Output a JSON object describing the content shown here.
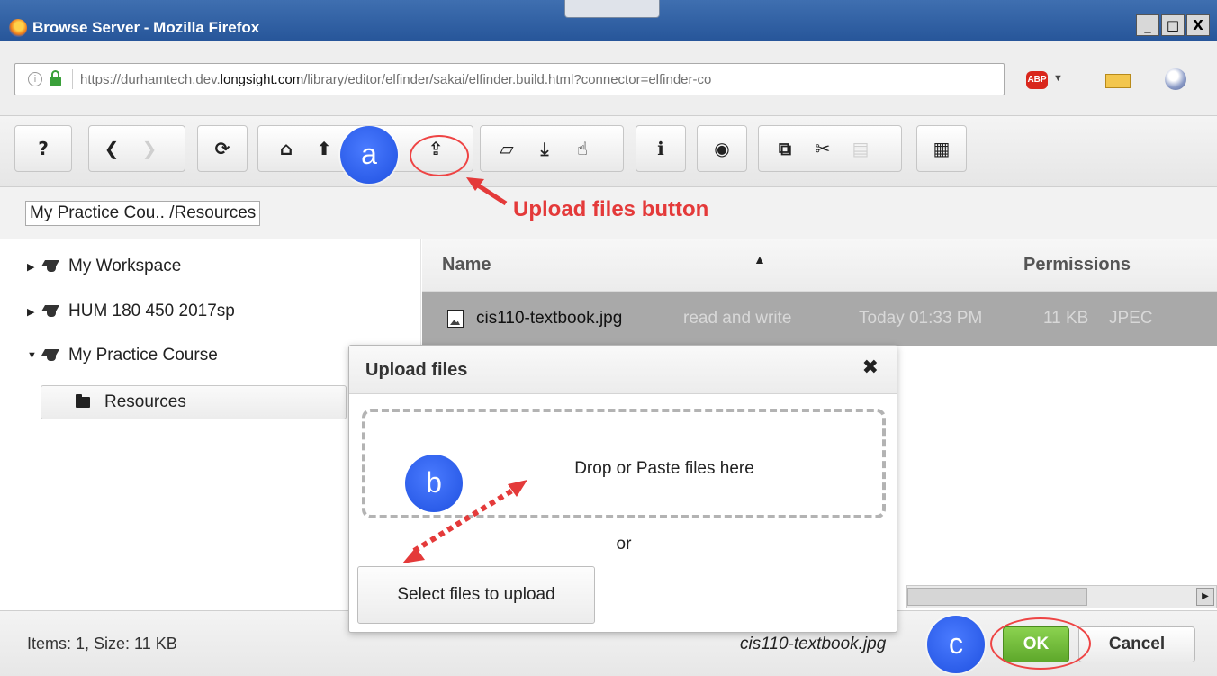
{
  "window": {
    "title": "Browse Server - Mozilla Firefox",
    "controls": [
      "_",
      "□",
      "X"
    ]
  },
  "address_bar": {
    "url_prefix": "https://durhamtech.dev.",
    "url_host": "longsight.com",
    "url_suffix": "/library/editor/elfinder/sakai/elfinder.build.html?connector=elfinder-co",
    "adblock_label": "ABP"
  },
  "toolbar": {
    "buttons": [
      "help-icon",
      "back-icon",
      "forward-icon",
      "reload-icon",
      "home-icon",
      "up-icon",
      "upload-icon",
      "open-icon",
      "download-icon",
      "select-icon",
      "info-icon",
      "preview-icon",
      "copy-icon",
      "cut-icon",
      "paste-icon",
      "view-icon"
    ]
  },
  "breadcrumb": {
    "path": "My Practice Cou.. /Resources"
  },
  "tree": {
    "items": [
      {
        "label": "My Workspace",
        "expanded": false
      },
      {
        "label": "HUM 180 450 2017sp",
        "expanded": false
      },
      {
        "label": "My Practice Course",
        "expanded": true
      }
    ],
    "selected_folder": "Resources"
  },
  "list": {
    "headers": {
      "name": "Name",
      "permissions": "Permissions"
    },
    "rows": [
      {
        "name": "cis110-textbook.jpg",
        "permissions": "read and write",
        "modified": "Today 01:33 PM",
        "size": "11 KB",
        "kind": "JPEC"
      }
    ]
  },
  "status": {
    "summary": "Items: 1, Size: 11 KB",
    "selected_file": "cis110-textbook.jpg",
    "ok_label": "OK",
    "cancel_label": "Cancel"
  },
  "dialog": {
    "title": "Upload files",
    "close": "✖",
    "drop_text": "Drop or Paste files here",
    "or_text": "or",
    "select_label": "Select files to upload"
  },
  "annotations": {
    "badge_a": "a",
    "badge_b": "b",
    "badge_c": "c",
    "upload_callout": "Upload files button",
    "accent_color": "#e43a3a",
    "badge_color": "#2a5cf0"
  }
}
